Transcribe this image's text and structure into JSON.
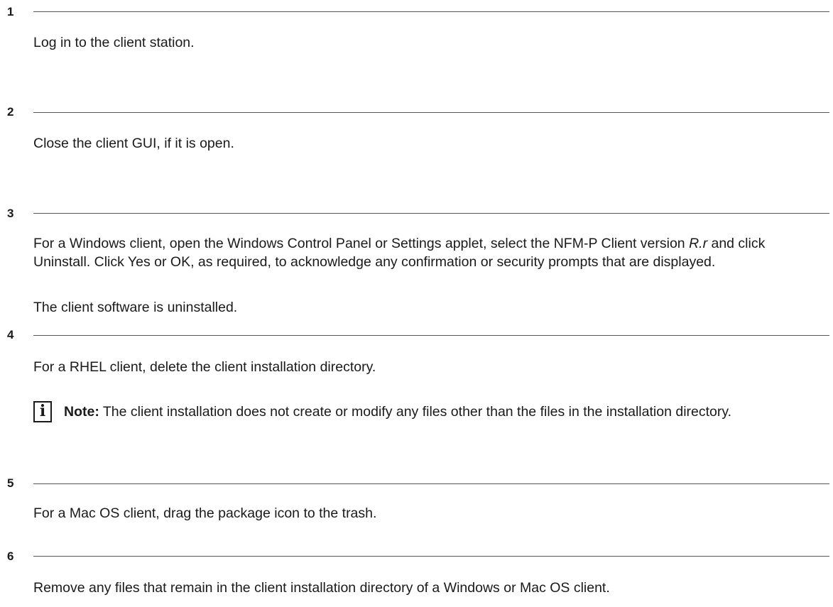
{
  "steps": [
    {
      "number": "1",
      "paragraphs": [
        "Log in to the client station."
      ]
    },
    {
      "number": "2",
      "paragraphs": [
        "Close the client GUI, if it is open."
      ]
    },
    {
      "number": "3",
      "instruction": {
        "before_version": "For a Windows client, open the Windows Control Panel or Settings applet, select the NFM-P Client version ",
        "version": "R.r",
        "after_version": " and click Uninstall. Click Yes or OK, as required, to acknowledge any confirmation or security prompts that are displayed."
      },
      "result": "The client software is uninstalled."
    },
    {
      "number": "4",
      "paragraphs": [
        "For a RHEL client, delete the client installation directory."
      ],
      "note": {
        "icon": "info-icon",
        "icon_glyph": "i",
        "label": "Note:",
        "text": " The client installation does not create or modify any files other than the files in the installation directory."
      }
    },
    {
      "number": "5",
      "paragraphs": [
        "For a Mac OS client, drag the package icon to the trash."
      ]
    },
    {
      "number": "6",
      "paragraphs": [
        "Remove any files that remain in the client installation directory of a Windows or Mac OS client."
      ]
    }
  ]
}
